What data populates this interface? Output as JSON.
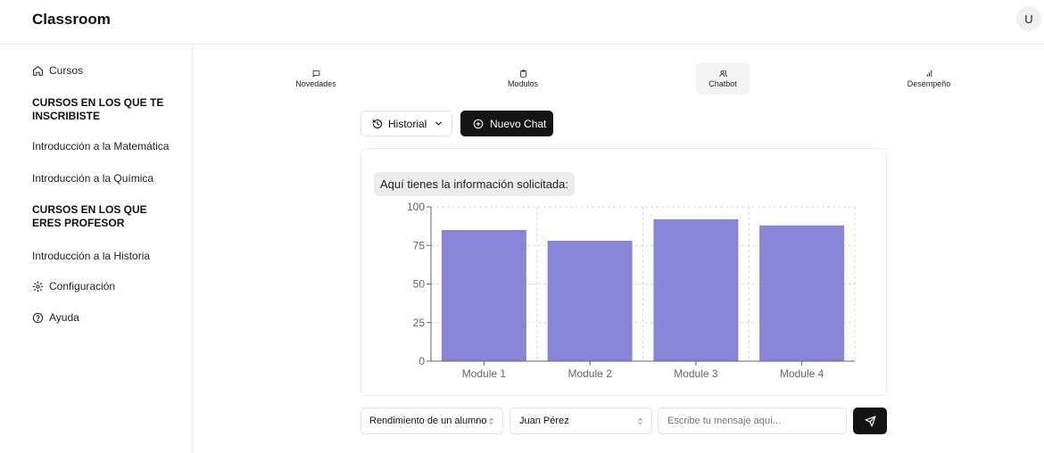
{
  "header": {
    "app_title": "Classroom",
    "avatar_initial": "U"
  },
  "sidebar": {
    "cursos_label": "Cursos",
    "enrolled_heading": "CURSOS EN LOS QUE TE INSCRIBISTE",
    "enrolled_courses": [
      "Introducción a la Matemática",
      "Introducción a la Química"
    ],
    "teacher_heading": "CURSOS EN LOS QUE ERES PROFESOR",
    "teacher_courses": [
      "Introducción a la Historia"
    ],
    "config_label": "Configuración",
    "help_label": "Ayuda"
  },
  "tabs": [
    {
      "label": "Novedades",
      "icon": "message-square-icon"
    },
    {
      "label": "Modulos",
      "icon": "clipboard-icon"
    },
    {
      "label": "Chatbot",
      "icon": "users-icon",
      "active": true
    },
    {
      "label": "Desempeño",
      "icon": "bar-chart-icon"
    }
  ],
  "chat": {
    "historial_label": "Historial",
    "nuevo_chat_label": "Nuevo Chat",
    "bot_message": "Aquí tienes la información solicitada:"
  },
  "chart_data": {
    "type": "bar",
    "categories": [
      "Module 1",
      "Module 2",
      "Module 3",
      "Module 4"
    ],
    "values": [
      85,
      78,
      92,
      88
    ],
    "ylim": [
      0,
      100
    ],
    "yticks": [
      0,
      25,
      50,
      75,
      100
    ],
    "grid": true,
    "bar_color": "#8884d8"
  },
  "footer": {
    "report_select": "Rendimiento de un alumno",
    "student_select": "Juan Pérez",
    "message_placeholder": "Escribe tu mensaje aquí..."
  },
  "colors": {
    "primary_button": "#141414",
    "bar": "#8884d8",
    "border": "#ececec"
  }
}
